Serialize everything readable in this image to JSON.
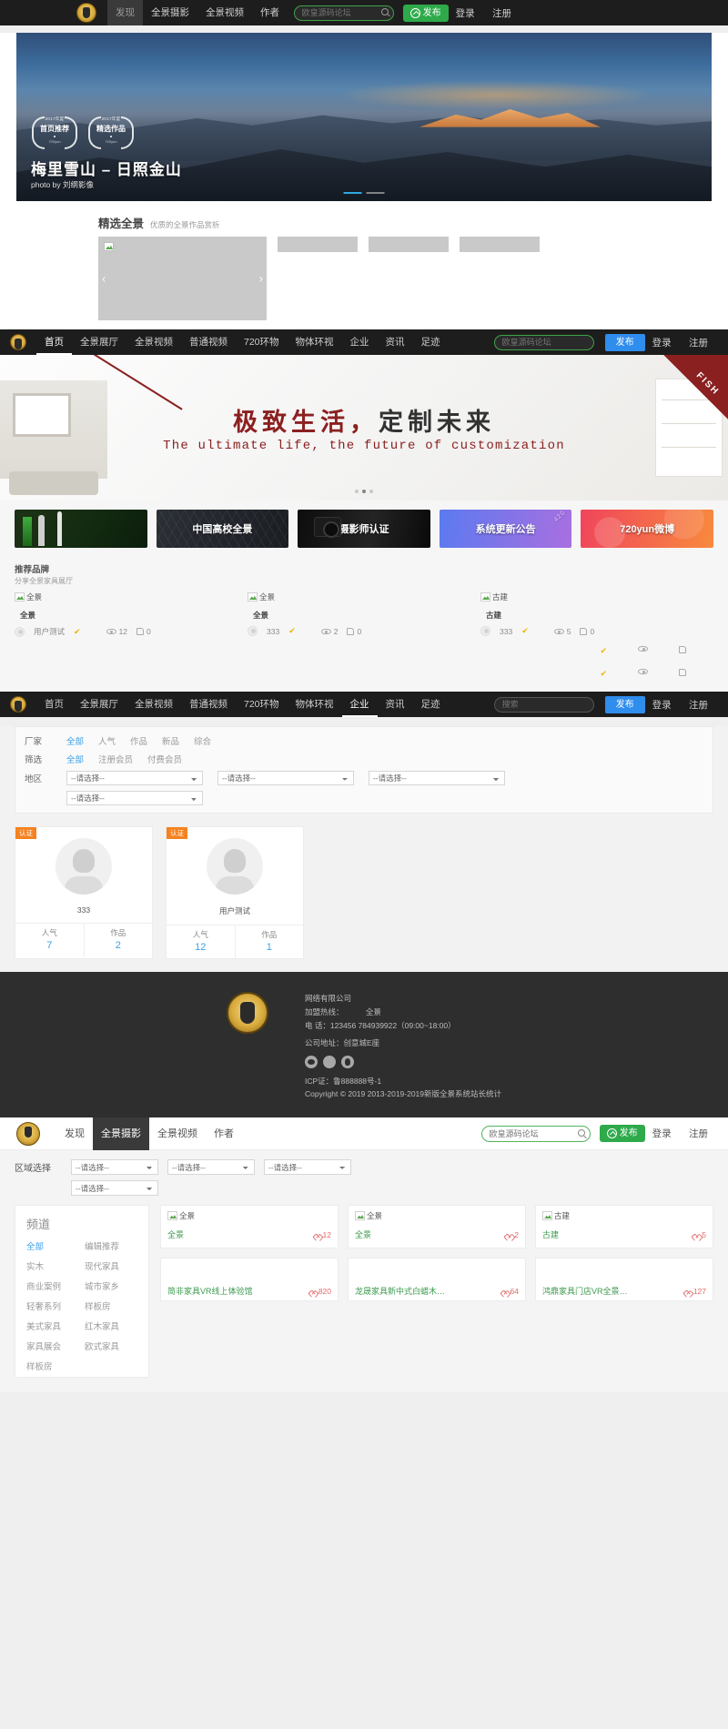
{
  "nav_top": {
    "logo": "site-logo",
    "links": [
      {
        "label": "发现",
        "active": true
      },
      {
        "label": "全景摄影",
        "active": false
      },
      {
        "label": "全景视频",
        "active": false
      },
      {
        "label": "作者",
        "active": false
      }
    ],
    "search_placeholder": "欧皇源码论坛",
    "publish_label": "发布",
    "login_label": "登录",
    "register_label": "注册"
  },
  "hero": {
    "badges": [
      {
        "year": "2017年度",
        "name": "首页推荐",
        "sub": "720yun"
      },
      {
        "year": "2017年度",
        "name": "精选作品",
        "sub": "720yun"
      }
    ],
    "title": "梅里雪山 – 日照金山",
    "subtitle": "photo by 刘纲影像",
    "dots": 2,
    "active_dot": 0
  },
  "featured": {
    "title": "精选全景",
    "subtitle": "优质的全景作品赏析",
    "image_alt": "全景",
    "prev": "‹",
    "next": "›",
    "thumbs": [
      "",
      "",
      ""
    ]
  },
  "nav_second": {
    "links": [
      {
        "label": "首页",
        "active": true
      },
      {
        "label": "全景展厅",
        "active": false
      },
      {
        "label": "全景视频",
        "active": false
      },
      {
        "label": "普通视频",
        "active": false
      },
      {
        "label": "720环物",
        "active": false
      },
      {
        "label": "物体环视",
        "active": false
      },
      {
        "label": "企业",
        "active": false
      },
      {
        "label": "资讯",
        "active": false
      },
      {
        "label": "足迹",
        "active": false
      }
    ],
    "search_placeholder": "欧皇源码论坛",
    "publish_label": "发布",
    "login_label": "登录",
    "register_label": "注册"
  },
  "banner": {
    "corner_text": "FISH",
    "title_red": "极致生活，",
    "title_dark": "定制未来",
    "subtitle": "The ultimate life, the future of customization",
    "dots": 3,
    "active_dot": 1
  },
  "tiles": [
    {
      "label": "",
      "kind": "rocket"
    },
    {
      "label": "中国高校全景",
      "kind": "campus"
    },
    {
      "label": "摄影师认证",
      "kind": "photographer"
    },
    {
      "label": "系统更新公告",
      "kind": "system",
      "corner": "420"
    },
    {
      "label": "720yun微博",
      "kind": "weibo"
    }
  ],
  "brands": {
    "title": "推荐品牌",
    "subtitle": "分享全景家具展厅",
    "items": [
      {
        "image_alt": "全景",
        "name": "全景",
        "author": "用户测试",
        "verified": true,
        "views": "12",
        "likes": "0"
      },
      {
        "image_alt": "全景",
        "name": "全景",
        "author": "333",
        "verified": true,
        "views": "2",
        "likes": "0"
      },
      {
        "image_alt": "古建",
        "name": "古建",
        "author": "333",
        "verified": true,
        "views": "5",
        "likes": "0"
      }
    ]
  },
  "nav_third": {
    "links": [
      {
        "label": "首页",
        "active": false
      },
      {
        "label": "全景展厅",
        "active": false
      },
      {
        "label": "全景视频",
        "active": false
      },
      {
        "label": "普通视频",
        "active": false
      },
      {
        "label": "720环物",
        "active": false
      },
      {
        "label": "物体环视",
        "active": false
      },
      {
        "label": "企业",
        "active": true
      },
      {
        "label": "资讯",
        "active": false
      },
      {
        "label": "足迹",
        "active": false
      }
    ],
    "search_placeholder": "搜索",
    "publish_label": "发布",
    "login_label": "登录",
    "register_label": "注册"
  },
  "filters": {
    "rows": [
      {
        "label": "厂家",
        "options": [
          {
            "text": "全部",
            "active": true
          },
          {
            "text": "人气",
            "active": false
          },
          {
            "text": "作品",
            "active": false
          },
          {
            "text": "新品",
            "active": false
          },
          {
            "text": "综合",
            "active": false
          }
        ]
      },
      {
        "label": "筛选",
        "options": [
          {
            "text": "全部",
            "active": true
          },
          {
            "text": "注册会员",
            "active": false
          },
          {
            "text": "付费会员",
            "active": false
          }
        ]
      }
    ],
    "region_label": "地区",
    "select_value": "--请选择--",
    "selects_row1": [
      "--请选择--",
      "--请选择--",
      "--请选择--"
    ],
    "selects_row2": [
      "--请选择--"
    ]
  },
  "user_cards": {
    "cert_label": "认证",
    "stat_popularity_label": "人气",
    "stat_works_label": "作品",
    "items": [
      {
        "name": "333",
        "popularity": "7",
        "works": "2"
      },
      {
        "name": "用户测试",
        "popularity": "12",
        "works": "1"
      }
    ]
  },
  "footer": {
    "company": "网络有限公司",
    "hotline_label": "加盟热线：",
    "hotline_value": "全景",
    "phone": "电 话：123456 784939922（09:00~18:00）",
    "address": "公司地址：创意城E座",
    "icp": "ICP证：鲁888888号-1",
    "copyright": "Copyright © 2019 2013-2019-2019新版全景系统站长统计",
    "social": [
      "wechat-icon",
      "weibo-icon",
      "qq-icon"
    ]
  },
  "nav_fourth": {
    "links": [
      {
        "label": "发现",
        "active": false
      },
      {
        "label": "全景摄影",
        "active": true
      },
      {
        "label": "全景视频",
        "active": false
      },
      {
        "label": "作者",
        "active": false
      }
    ],
    "search_placeholder": "欧皇源码论坛",
    "publish_label": "发布",
    "login_label": "登录",
    "register_label": "注册"
  },
  "region_picker": {
    "label": "区域选择",
    "row1": [
      "--请选择--",
      "--请选择--",
      "--请选择--"
    ],
    "row2": [
      "--请选择--"
    ]
  },
  "channels": {
    "title": "频道",
    "items": [
      {
        "label": "全部",
        "active": true
      },
      {
        "label": "编辑推荐",
        "active": false
      },
      {
        "label": "实木",
        "active": false
      },
      {
        "label": "现代家具",
        "active": false
      },
      {
        "label": "商业案例",
        "active": false
      },
      {
        "label": "城市家乡",
        "active": false
      },
      {
        "label": "轻奢系列",
        "active": false
      },
      {
        "label": "样板房",
        "active": false
      },
      {
        "label": "美式家具",
        "active": false
      },
      {
        "label": "红木家具",
        "active": false
      },
      {
        "label": "家具展会",
        "active": false
      },
      {
        "label": "欧式家具",
        "active": false
      },
      {
        "label": "样板房",
        "active": false
      }
    ]
  },
  "works": [
    {
      "image_alt": "全景",
      "title": "全景",
      "likes": "12",
      "broken": true
    },
    {
      "image_alt": "全景",
      "title": "全景",
      "likes": "2",
      "broken": true
    },
    {
      "image_alt": "古建",
      "title": "古建",
      "likes": "5",
      "broken": true
    },
    {
      "image_alt": "",
      "title": "简非家具VR线上体验馆",
      "likes": "820",
      "broken": false
    },
    {
      "image_alt": "",
      "title": "龙晟家具新中式白蜡木…",
      "likes": "64",
      "broken": false
    },
    {
      "image_alt": "",
      "title": "鸿鼎家具门店VR全景…",
      "likes": "127",
      "broken": false
    }
  ],
  "colors": {
    "green_accent": "#2eaa4b",
    "blue_accent": "#2f8ded",
    "orange_badge": "#f58220",
    "red_brand": "#8b2020",
    "link_blue": "#3aa0e8",
    "work_title_green": "#3c9a4e",
    "heart_red": "#e26b6b",
    "dark_nav": "#1d1d1d",
    "footer_bg": "#2e2e2e"
  }
}
